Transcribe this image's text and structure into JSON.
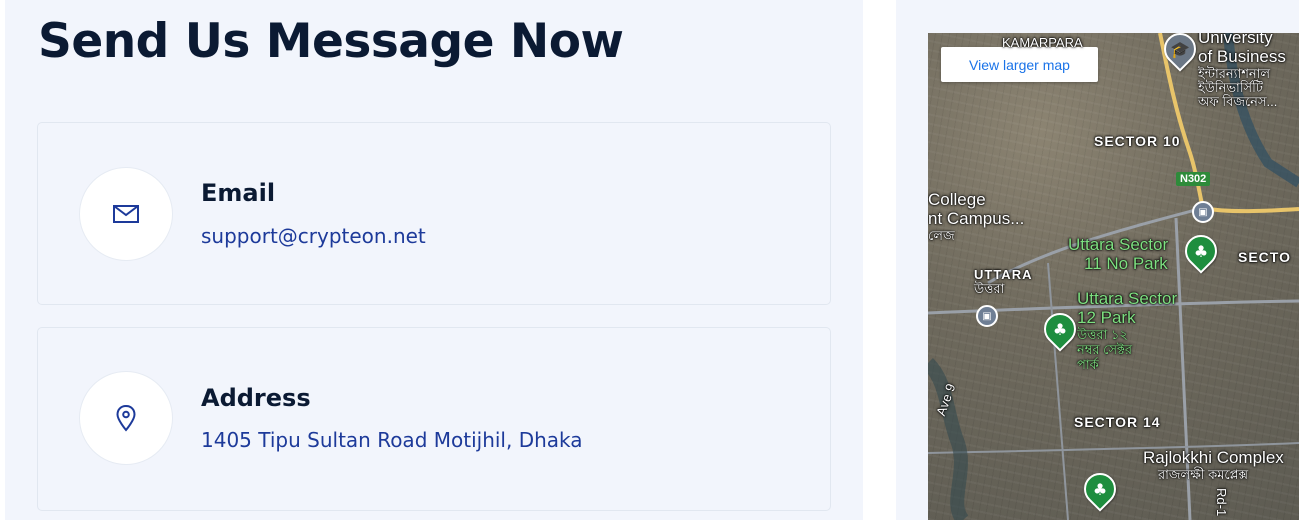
{
  "contact": {
    "title": "Send Us Message Now",
    "email": {
      "label": "Email",
      "value": "support@crypteon.net",
      "icon": "envelope-icon"
    },
    "address": {
      "label": "Address",
      "value": "1405 Tipu Sultan Road Motijhil, Dhaka",
      "icon": "location-pin-icon"
    }
  },
  "map": {
    "view_larger_label": "View larger map",
    "labels": {
      "kamarpara": "KAMARPARA",
      "university_en_1": "University",
      "university_en_2": "of Business",
      "university_bn_1": "ইন্টারন্যাশনাল",
      "university_bn_2": "ইউনিভার্সিটি",
      "university_bn_3": "অফ বিজনেস...",
      "sector10": "SECTOR 10",
      "route": "N302",
      "college_1": "College",
      "college_2": "nt Campus...",
      "college_bn": "লেজ",
      "park11_1": "Uttara Sector",
      "park11_2": "11 No Park",
      "sector_right": "SECTO",
      "uttara_en": "UTTARA",
      "uttara_bn": "উত্তরা",
      "park12_1": "Uttara Sector",
      "park12_2": "12 Park",
      "park12_bn_1": "উত্তরা ১২",
      "park12_bn_2": "নম্বর সেক্টর",
      "park12_bn_3": "পার্ক",
      "sector14": "SECTOR 14",
      "ave9": "Ave 9",
      "rajlokkhi_en": "Rajlokkhi Complex",
      "rajlokkhi_bn": "রাজলক্ষী কমপ্লেক্স",
      "rd": "Rd-1"
    }
  }
}
